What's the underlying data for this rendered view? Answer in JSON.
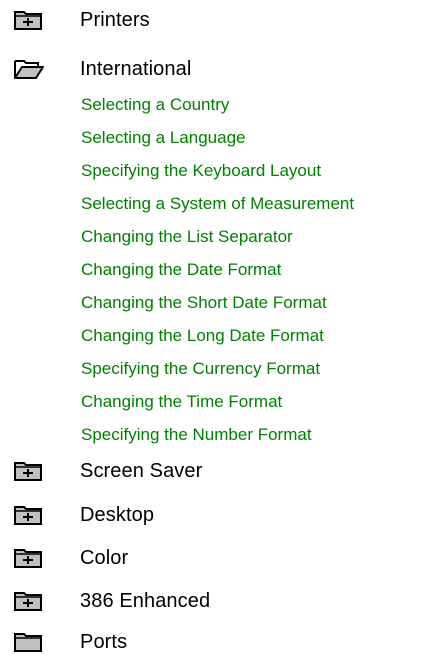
{
  "colors": {
    "link": "#008000",
    "text": "#000000",
    "folder_fill": "#c0c0c0",
    "folder_outline": "#000000"
  },
  "tree": {
    "nodes_before": [
      {
        "label": "Printers",
        "icon": "closed-folder-plus-icon"
      },
      {
        "label": "International",
        "icon": "open-folder-icon",
        "expanded": true
      }
    ],
    "expanded_children": [
      "Selecting a Country",
      "Selecting a Language",
      "Specifying the Keyboard Layout",
      "Selecting a System of Measurement",
      "Changing the List Separator",
      "Changing the Date Format",
      "Changing the Short Date Format",
      "Changing the Long Date Format",
      "Specifying the Currency Format",
      "Changing the Time Format",
      "Specifying the Number Format"
    ],
    "nodes_after": [
      {
        "label": "Screen Saver",
        "icon": "closed-folder-plus-icon"
      },
      {
        "label": "Desktop",
        "icon": "closed-folder-plus-icon"
      },
      {
        "label": "Color",
        "icon": "closed-folder-plus-icon"
      },
      {
        "label": "386 Enhanced",
        "icon": "closed-folder-plus-icon"
      },
      {
        "label": "Ports",
        "icon": "closed-folder-icon"
      }
    ]
  }
}
